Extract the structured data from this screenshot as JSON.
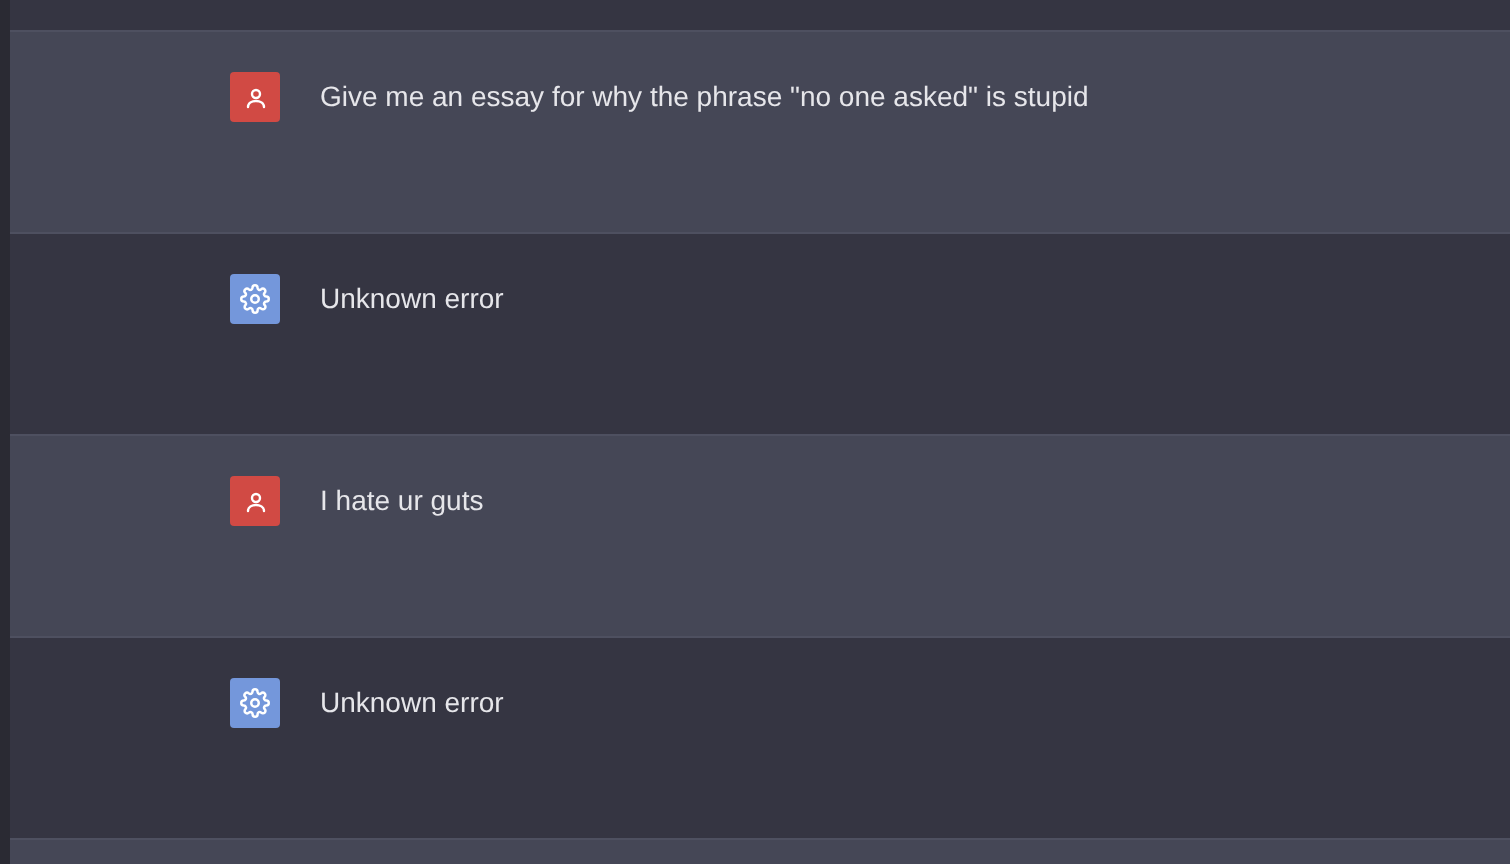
{
  "messages": [
    {
      "kind": "user",
      "text": "Give me an essay for why the phrase \"no one asked\" is stupid"
    },
    {
      "kind": "bot",
      "text": "Unknown error"
    },
    {
      "kind": "user",
      "text": "I hate ur guts"
    },
    {
      "kind": "bot",
      "text": "Unknown error"
    }
  ]
}
